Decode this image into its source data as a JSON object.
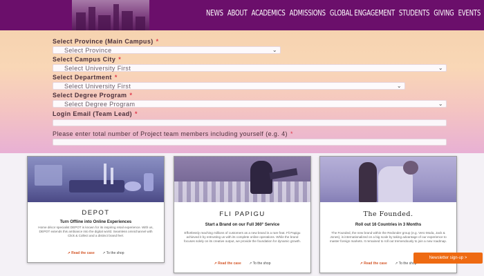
{
  "header": {
    "nav": [
      "NEWS",
      "ABOUT",
      "ACADEMICS",
      "ADMISSIONS",
      "GLOBAL ENGAGEMENT",
      "STUDENTS",
      "GIVING",
      "EVENTS"
    ]
  },
  "form": {
    "province_label": "Select Province (Main Campus)",
    "province_value": "Select Province",
    "city_label": "Select Campus City",
    "city_value": "Select University First",
    "department_label": "Select Department",
    "department_value": "Select University First",
    "degree_label": "Select Degree Program",
    "degree_value": "Select Degree Program",
    "email_label": "Login Email (Team Lead)",
    "members_label": "Please enter total number of Project team members including yourself (e.g. 4)",
    "required_mark": "*"
  },
  "cards": [
    {
      "brand": "DEPOT",
      "tagline": "Turn Offline into Online Experiences",
      "description": "Home décor specialist DEPOT is known for its inspiring retail experience. With us, DEPOT extends this ambiance into the digital world. Seamless omnichannel with Click & Collect and a distinct brand feel.",
      "case_link": "Read the case",
      "shop_link": "To the shop"
    },
    {
      "brand": "FLI PAPIGU",
      "tagline": "Start a Brand on our Full 360° Service",
      "description": "Effortlessly reaching millions of customers as a new brand is a rare feat. Fli Papigu achieved it by entrusting us with its complete online operations. While the brand focuses solely on its creative output, we provide the foundation for dynamic growth.",
      "case_link": "Read the case",
      "shop_link": "To the shop"
    },
    {
      "brand": "The Founded.",
      "tagline": "Roll out 16 Countries in 3 Months",
      "description": "The Founded, the new brand within the Redonder group (e.g. Vero Moda, Jack & Jones), is internationalized on a big scale by taking advantage of our experience to master foreign markets. It remained to roll out tremendously to join a new roadmap.",
      "case_link": "Read the case",
      "shop_link": "To the shop"
    }
  ],
  "newsletter": "Newsletter sign-up >"
}
